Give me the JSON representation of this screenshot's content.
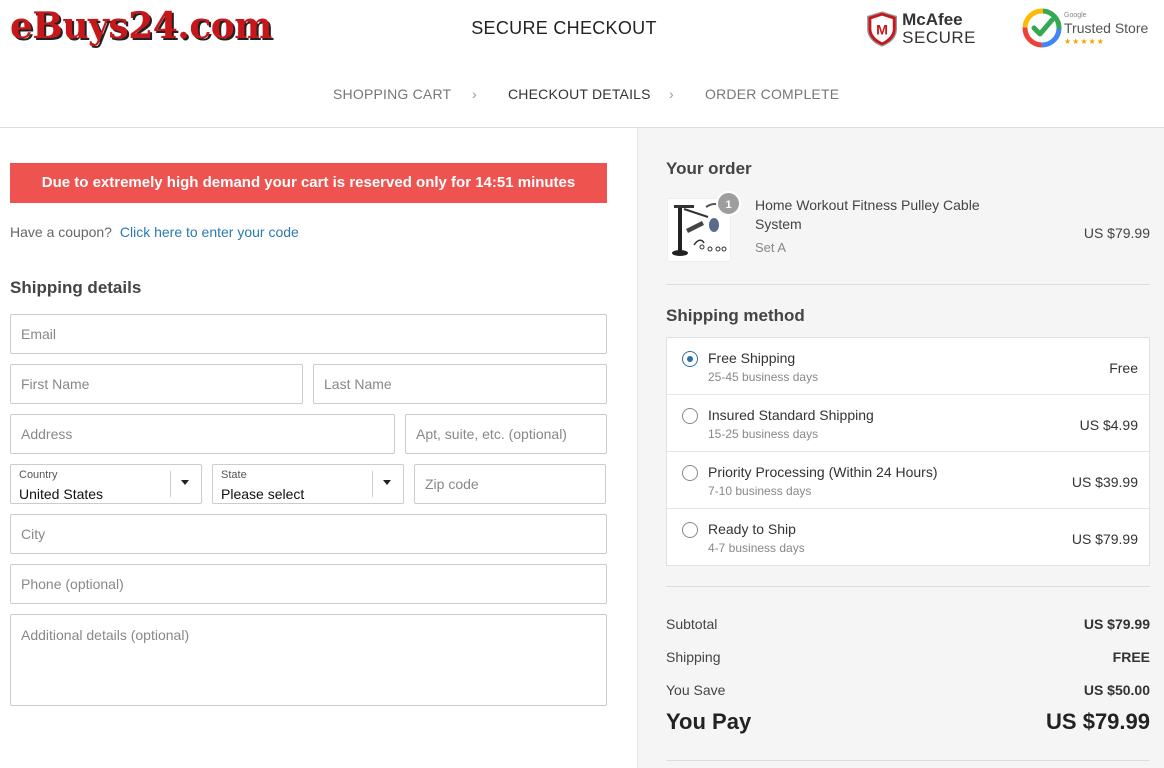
{
  "header": {
    "logo": "eBuys24.com",
    "title": "SECURE CHECKOUT",
    "mcafee": {
      "line1": "McAfee",
      "line2": "SECURE"
    },
    "trusted": {
      "small": "Google",
      "label": "Trusted Store",
      "stars": "★★★★★"
    }
  },
  "steps": [
    "SHOPPING CART",
    "CHECKOUT DETAILS",
    "ORDER COMPLETE"
  ],
  "timer_banner": "Due to extremely high demand your cart is reserved only for 14:51 minutes",
  "coupon": {
    "prompt": "Have a coupon?",
    "link": "Click here to enter your code"
  },
  "shipping_details": {
    "title": "Shipping details",
    "email": "Email",
    "first_name": "First Name",
    "last_name": "Last Name",
    "address": "Address",
    "apt": "Apt, suite, etc. (optional)",
    "country": {
      "label": "Country",
      "value": "United States"
    },
    "state": {
      "label": "State",
      "value": "Please select"
    },
    "zip": "Zip code",
    "city": "City",
    "phone": "Phone (optional)",
    "additional": "Additional details (optional)"
  },
  "order": {
    "title": "Your order",
    "item": {
      "quantity": "1",
      "name": "Home Workout Fitness Pulley Cable System",
      "variant": "Set A",
      "price": "US $79.99"
    }
  },
  "shipping_method": {
    "title": "Shipping method",
    "options": [
      {
        "name": "Free Shipping",
        "days": "25-45 business days",
        "price": "Free",
        "selected": true
      },
      {
        "name": "Insured Standard Shipping",
        "days": "15-25 business days",
        "price": "US $4.99",
        "selected": false
      },
      {
        "name": "Priority Processing (Within 24 Hours)",
        "days": "7-10 business days",
        "price": "US $39.99",
        "selected": false
      },
      {
        "name": "Ready to Ship",
        "days": "4-7 business days",
        "price": "US $79.99",
        "selected": false
      }
    ]
  },
  "totals": {
    "subtotal_label": "Subtotal",
    "subtotal": "US $79.99",
    "shipping_label": "Shipping",
    "shipping": "FREE",
    "save_label": "You Save",
    "save": "US $50.00",
    "pay_label": "You Pay",
    "pay": "US $79.99"
  },
  "colors": {
    "banner": "#ef5350",
    "link": "#2a7ab0",
    "radio_selected": "#2a6fa8",
    "logo": "#c8171b"
  }
}
